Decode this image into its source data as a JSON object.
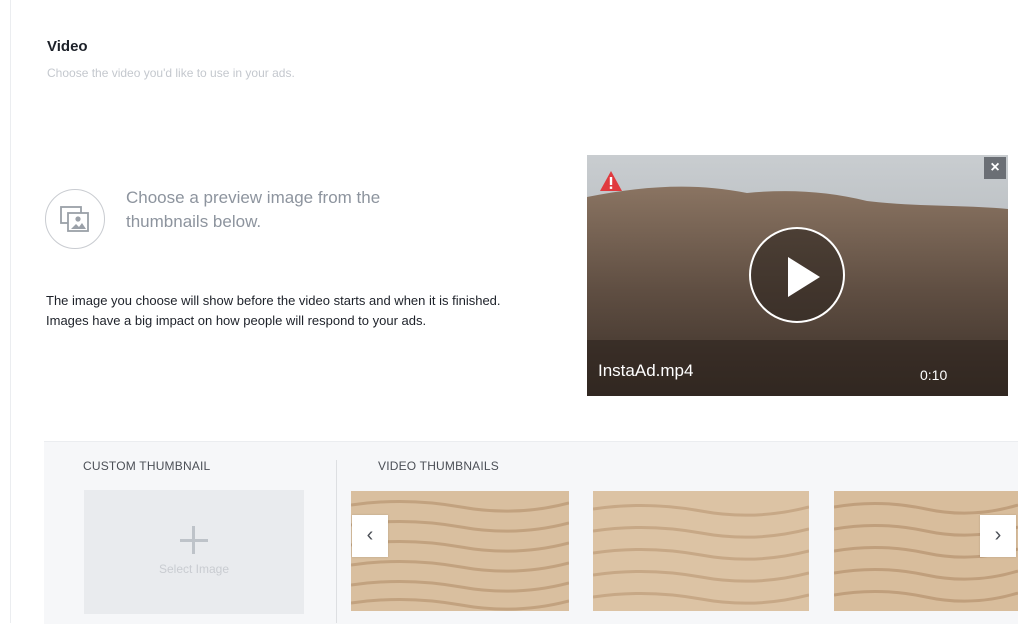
{
  "section": {
    "title": "Video",
    "subtitle": "Choose the video you'd like to use in your ads."
  },
  "preview": {
    "heading": "Choose a preview image from the thumbnails below.",
    "helper": "The image you choose will show before the video starts and when it is finished. Images have a big impact on how people will respond to your ads.",
    "icon": "image-picker-icon"
  },
  "video": {
    "filename": "InstaAd.mp4",
    "duration": "0:10",
    "warning_icon": "warning-icon",
    "close_label": "×",
    "play_icon": "play-icon"
  },
  "thumbnails": {
    "custom_heading": "CUSTOM THUMBNAIL",
    "select_label": "Select Image",
    "video_heading": "VIDEO THUMBNAILS",
    "prev_label": "‹",
    "next_label": "›"
  },
  "colors": {
    "warning": "#e03a3e",
    "sand_light": "#dcc2a3",
    "sand_dark": "#c6a584"
  }
}
